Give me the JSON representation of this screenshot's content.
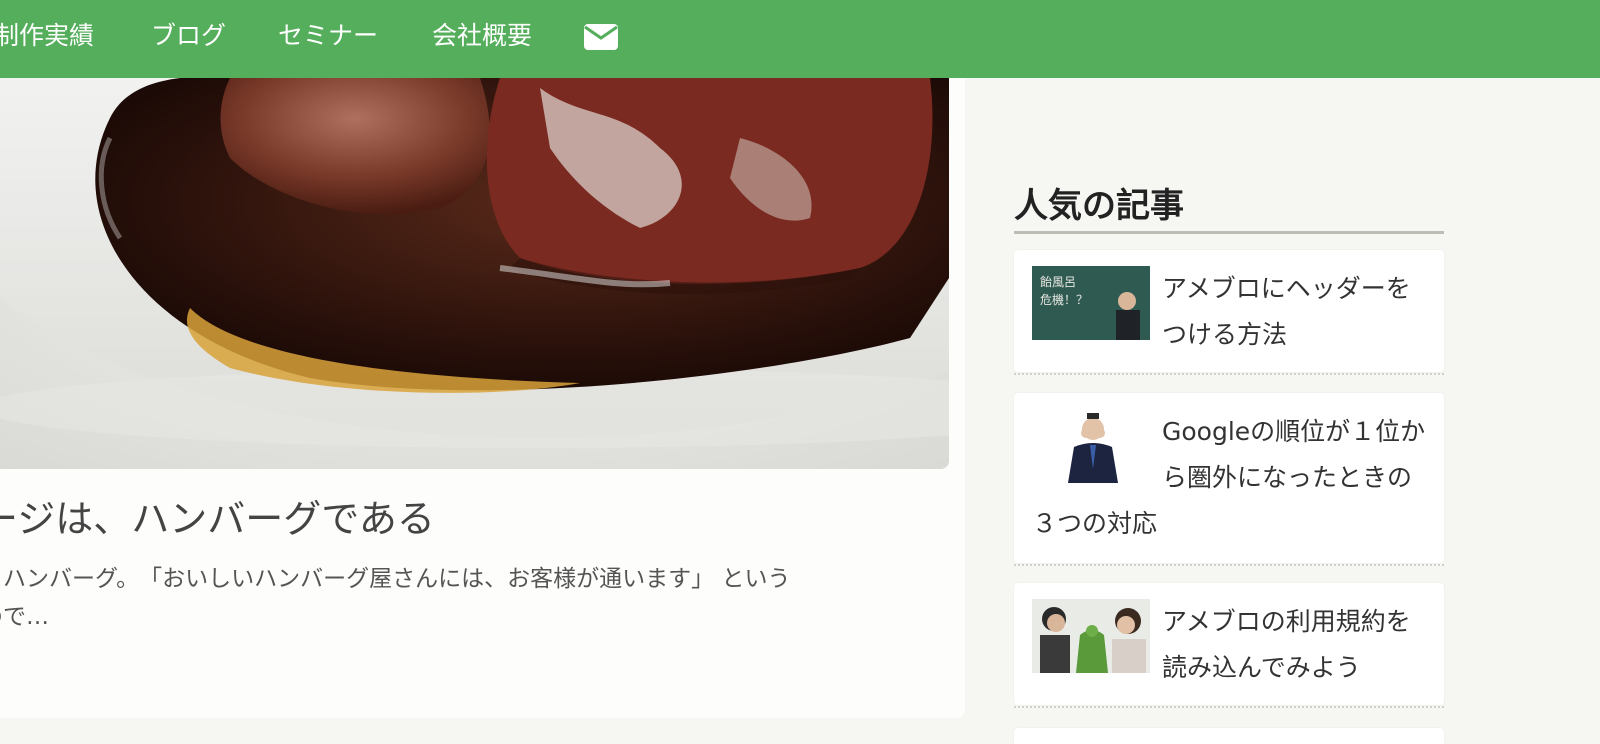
{
  "nav": {
    "items": [
      "制作実績",
      "ブログ",
      "セミナー",
      "会社概要"
    ],
    "mail_icon": "envelope-icon",
    "background": "#55ae5b"
  },
  "article": {
    "title": "ージは、ハンバーグである",
    "excerpt": "、ハンバーグ。　「おいしいハンバーグ屋さんには、お客様が通います」 という\nので…"
  },
  "sidebar": {
    "title": "人気の記事",
    "items": [
      {
        "title": "アメブロにヘッダーをつける方法",
        "thumb_text": "飴風呂\n危機！？"
      },
      {
        "title": "Googleの順位が１位から圏外になったときの３つの対応"
      },
      {
        "title": "アメブロの利用規約を読み込んでみよう"
      }
    ]
  }
}
